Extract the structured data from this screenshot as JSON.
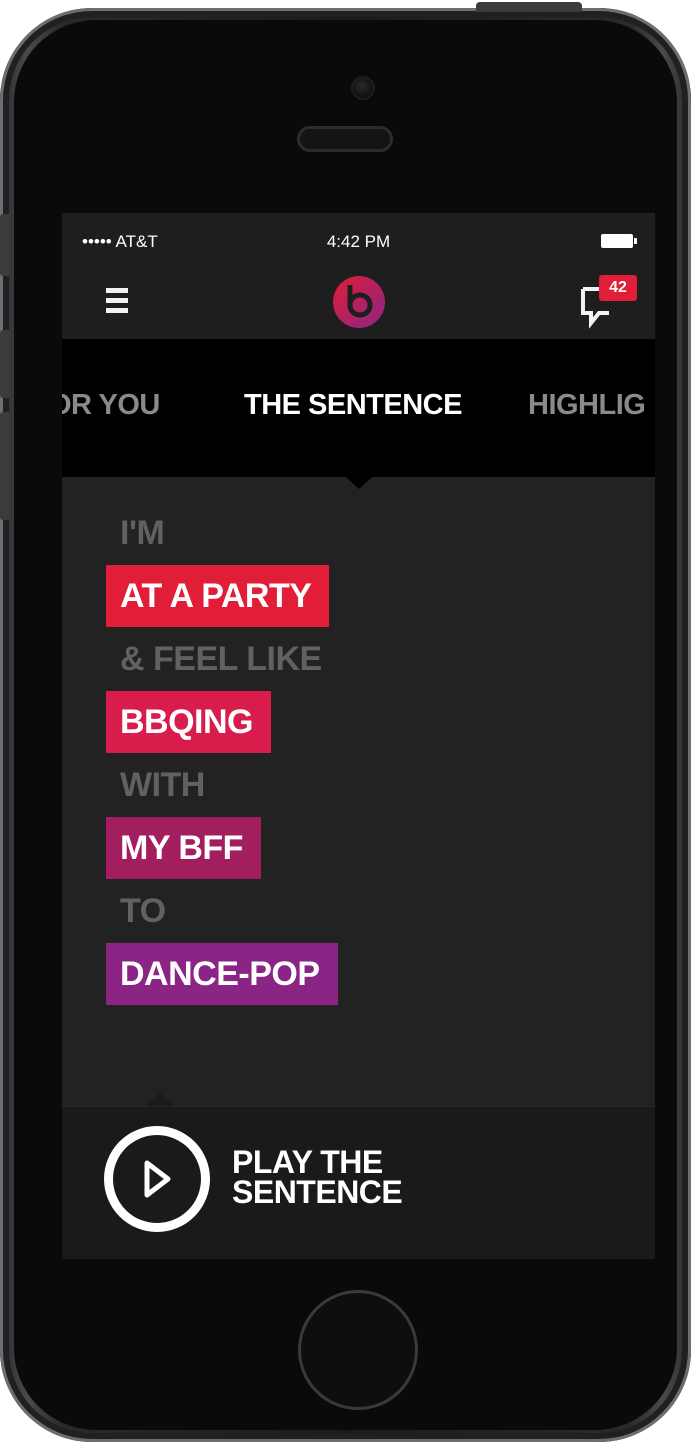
{
  "status_bar": {
    "carrier": "••••• AT&T",
    "time": "4:42 PM"
  },
  "nav": {
    "menu_icon": "hamburger-menu-icon",
    "logo_icon": "beats-logo-icon",
    "chat_icon": "chat-bubble-icon",
    "notification_count": "42"
  },
  "tabs": [
    {
      "label": "OR YOU",
      "active": false
    },
    {
      "label": "THE SENTENCE",
      "active": true
    },
    {
      "label": "HIGHLIG",
      "active": false
    }
  ],
  "sentence": {
    "word_1": "I'M",
    "choice_1": "AT A PARTY",
    "word_2": "& FEEL LIKE",
    "choice_2": "BBQING",
    "word_3": "WITH",
    "choice_3": "MY BFF",
    "word_4": "TO",
    "choice_4": "DANCE-POP"
  },
  "play": {
    "line_1": "PLAY THE",
    "line_2": "SENTENCE",
    "icon": "play-icon"
  },
  "colors": {
    "choice_1": "#e11d37",
    "choice_2": "#d81c4c",
    "choice_3": "#a31e5e",
    "choice_4": "#8a2586",
    "static_text": "#616161",
    "screen_bg": "#222222"
  }
}
